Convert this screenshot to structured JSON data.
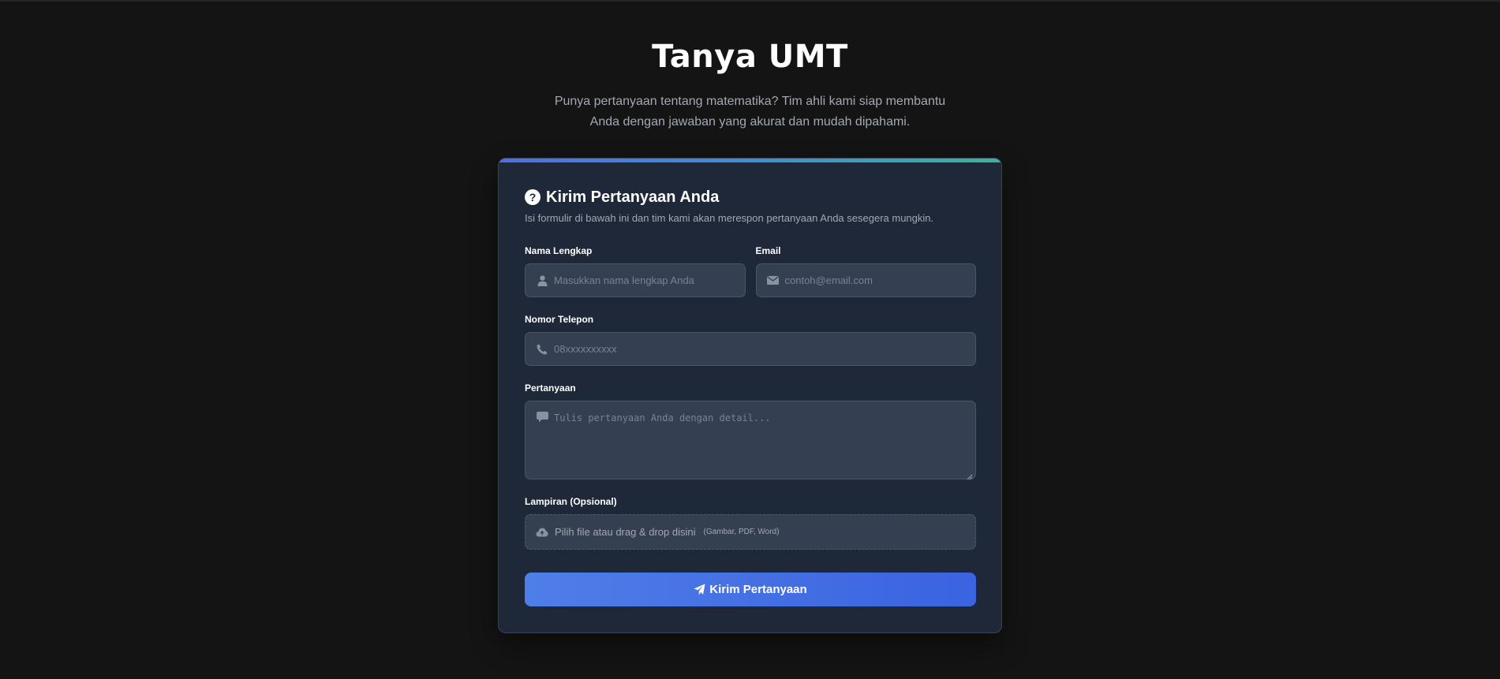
{
  "hero": {
    "title": "Tanya UMT",
    "subtitle": "Punya pertanyaan tentang matematika? Tim ahli kami siap membantu Anda dengan jawaban yang akurat dan mudah dipahami."
  },
  "form": {
    "title": "Kirim Pertanyaan Anda",
    "description": "Isi formulir di bawah ini dan tim kami akan merespon pertanyaan Anda sesegera mungkin.",
    "name": {
      "label": "Nama Lengkap",
      "placeholder": "Masukkan nama lengkap Anda",
      "value": "",
      "icon": "user-icon"
    },
    "email": {
      "label": "Email",
      "placeholder": "contoh@email.com",
      "value": "",
      "icon": "envelope-icon"
    },
    "phone": {
      "label": "Nomor Telepon",
      "placeholder": "08xxxxxxxxxx",
      "value": "",
      "icon": "phone-icon"
    },
    "question": {
      "label": "Pertanyaan",
      "placeholder": "Tulis pertanyaan Anda dengan detail...",
      "value": "",
      "icon": "comment-icon"
    },
    "attachment": {
      "label": "Lampiran (Opsional)",
      "text": "Pilih file atau drag & drop disini",
      "hint": "(Gambar, PDF, Word)",
      "icon": "cloud-upload-icon"
    },
    "submit_label": "Kirim Pertanyaan",
    "submit_icon": "paper-plane-icon"
  },
  "colors": {
    "background": "#141414",
    "card": "#1f2839",
    "input": "#353f52",
    "accent": "#4f7ee8",
    "accent_gradient_end": "#39b39a"
  }
}
